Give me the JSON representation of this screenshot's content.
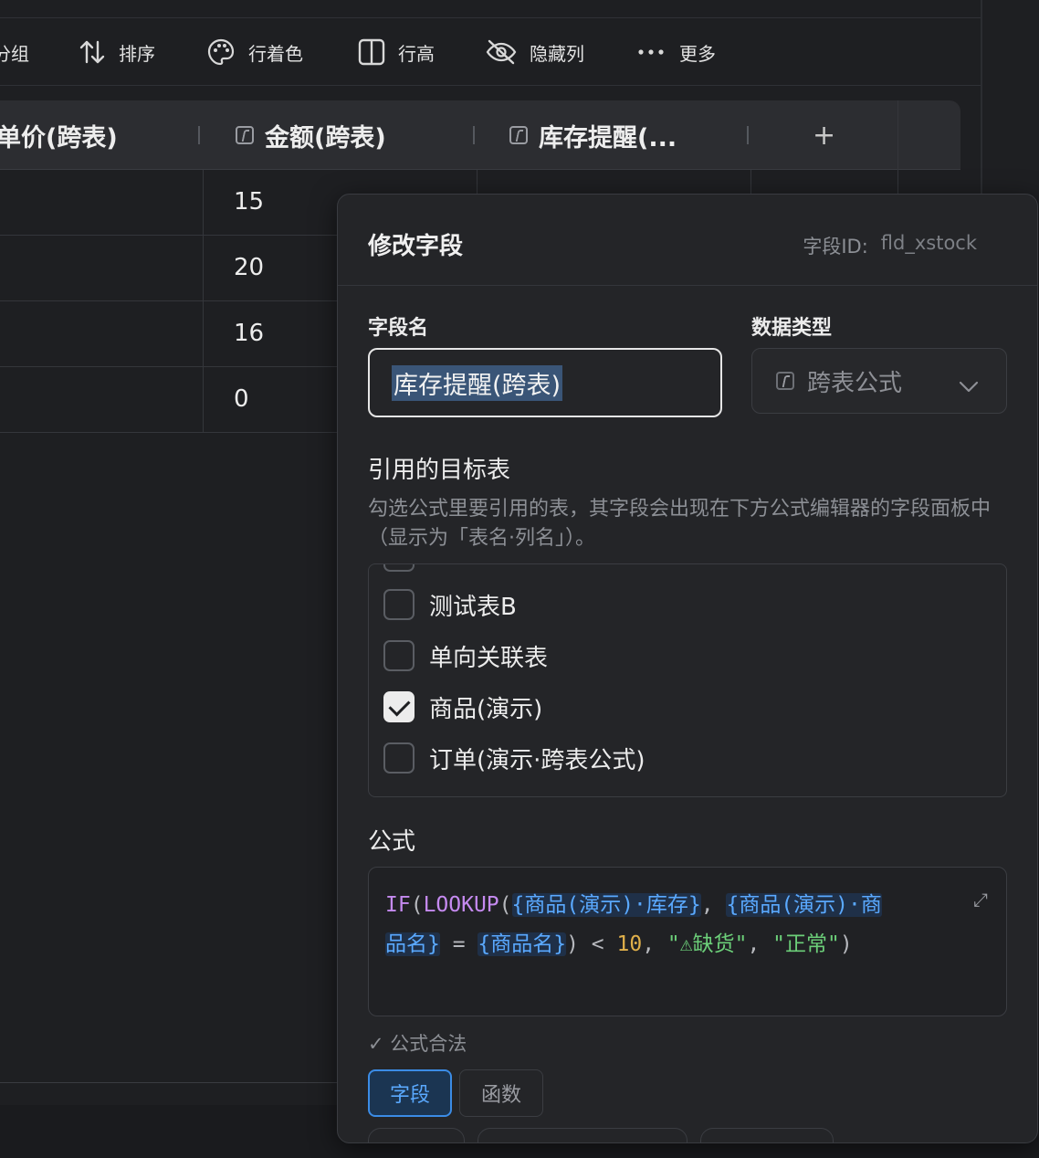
{
  "toolbar": {
    "items": [
      {
        "label": "分组",
        "icon": "group-icon"
      },
      {
        "label": "排序",
        "icon": "sort-icon"
      },
      {
        "label": "行着色",
        "icon": "palette-icon"
      },
      {
        "label": "行高",
        "icon": "row-height-icon"
      },
      {
        "label": "隐藏列",
        "icon": "eye-off-icon"
      },
      {
        "label": "更多",
        "icon": "more-icon"
      }
    ]
  },
  "table": {
    "headers": [
      "单价(跨表)",
      "金额(跨表)",
      "库存提醒(..."
    ],
    "add_column": "+",
    "amounts": [
      "15",
      "20",
      "16",
      "0"
    ]
  },
  "dialog": {
    "title": "修改字段",
    "field_id_label": "字段ID:",
    "field_id_value": "fld_xstock",
    "field_name_label": "字段名",
    "field_name_value": "库存提醒(跨表)",
    "data_type_label": "数据类型",
    "data_type_value": "跨表公式",
    "ref_tables_title": "引用的目标表",
    "ref_tables_desc": "勾选公式里要引用的表，其字段会出现在下方公式编辑器的字段面板中（显示为「表名·列名」）。",
    "tables": [
      {
        "name": "测试表B",
        "checked": false
      },
      {
        "name": "单向关联表",
        "checked": false
      },
      {
        "name": "商品(演示)",
        "checked": true
      },
      {
        "name": "订单(演示·跨表公式)",
        "checked": false
      }
    ],
    "formula_label": "公式",
    "formula": {
      "fn_if": "IF",
      "fn_lookup": "LOOKUP",
      "ref1": "{商品(演示)·库存}",
      "ref2a": "{商品(演示)·商",
      "ref2b": "品名}",
      "ref3": "{商品名}",
      "num": "10",
      "str1": "\"⚠缺货\"",
      "str2": "\"正常\""
    },
    "valid_text": "✓ 公式合法",
    "tabs": [
      "字段",
      "函数"
    ]
  },
  "colors": {
    "accent": "#3b8ce6",
    "background": "#1e1f22",
    "dialog_bg": "#242528"
  }
}
